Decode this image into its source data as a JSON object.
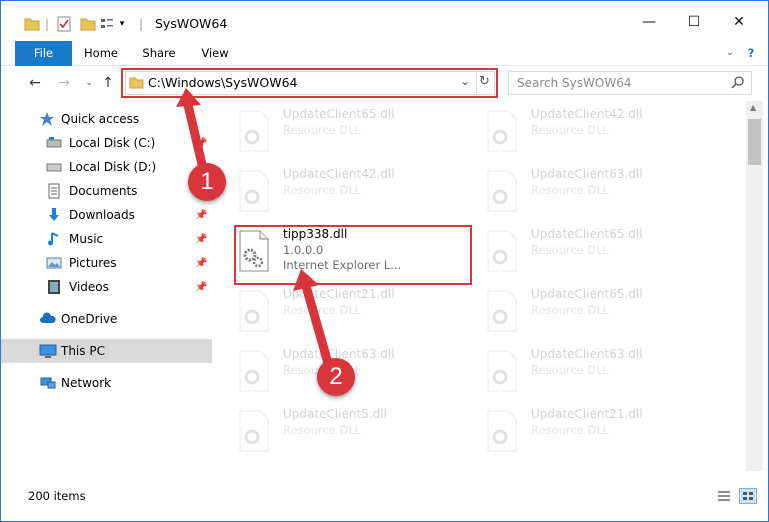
{
  "window": {
    "title": "SysWOW64",
    "controls": {
      "minimize": "—",
      "maximize": "☐",
      "close": "✕"
    }
  },
  "ribbon": {
    "tabs": [
      "File",
      "Home",
      "Share",
      "View"
    ],
    "help": "?"
  },
  "address": {
    "path": "C:\\Windows\\SysWOW64",
    "search_placeholder": "Search SysWOW64"
  },
  "sidebar": {
    "quick_access": "Quick access",
    "items": [
      "Local Disk (C:)",
      "Local Disk (D:)",
      "Documents",
      "Downloads",
      "Music",
      "Pictures",
      "Videos"
    ],
    "onedrive": "OneDrive",
    "this_pc": "This PC",
    "network": "Network"
  },
  "files": {
    "left": [
      {
        "name": "UpdateClient65.dll",
        "desc": "Resource DLL"
      },
      {
        "name": "UpdateClient42.dll",
        "desc": "Resource DLL"
      },
      {
        "name": "tipp338.dll",
        "version": "1.0.0.0",
        "desc": "Internet Explorer L..."
      },
      {
        "name": "UpdateClient21.dll",
        "desc": "Resource DLL"
      },
      {
        "name": "UpdateClient63.dll",
        "desc": "Resource DLL"
      },
      {
        "name": "UpdateClient5.dll",
        "desc": "Resource DLL"
      }
    ],
    "right": [
      {
        "name": "UpdateClient42.dll",
        "desc": "Resource DLL"
      },
      {
        "name": "UpdateClient63.dll",
        "desc": "Resource DLL"
      },
      {
        "name": "UpdateClient65.dll",
        "desc": "Resource DLL"
      },
      {
        "name": "UpdateClient65.dll",
        "desc": "Resource DLL"
      },
      {
        "name": "UpdateClient63.dll",
        "desc": "Resource DLL"
      },
      {
        "name": "UpdateClient21.dll",
        "desc": "Resource DLL"
      }
    ]
  },
  "status": {
    "count": "200 items"
  },
  "callouts": [
    "1",
    "2"
  ],
  "colors": {
    "accent": "#1979ca",
    "highlight": "#d8363b"
  }
}
